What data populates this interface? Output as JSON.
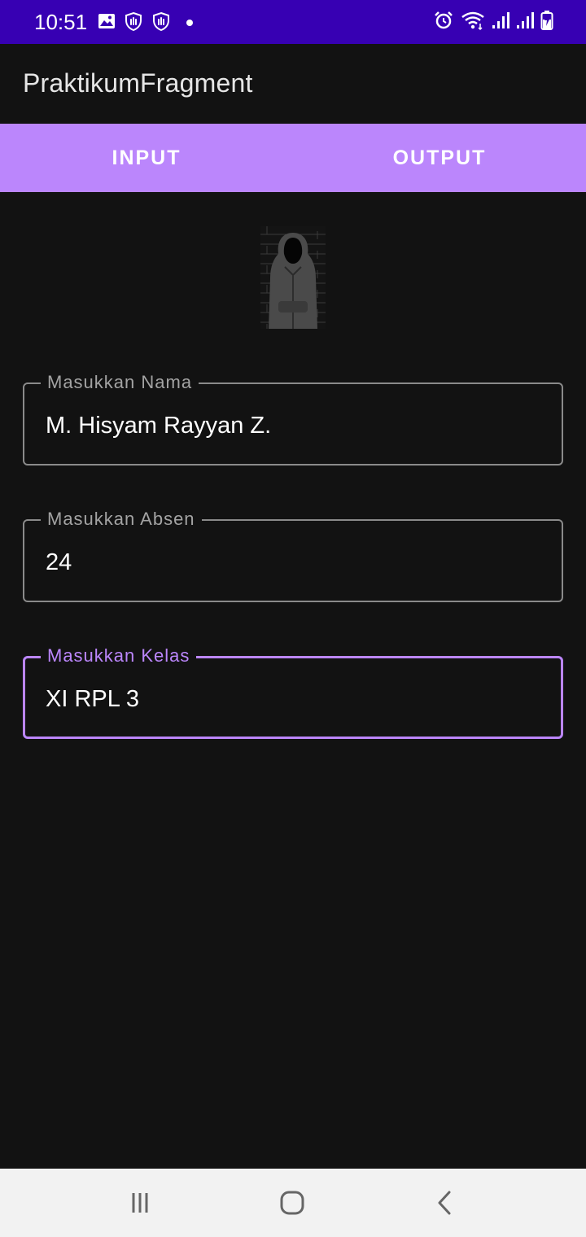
{
  "status_bar": {
    "time": "10:51",
    "left_icons": [
      "image-icon",
      "hand-shield-icon",
      "hand-shield-icon",
      "dot-icon"
    ],
    "right_icons": [
      "alarm-icon",
      "wifi-icon",
      "signal-icon",
      "signal-icon",
      "battery-charging-icon"
    ],
    "background": "#3700b3"
  },
  "app_bar": {
    "title": "PraktikumFragment"
  },
  "tabs": [
    {
      "label": "INPUT"
    },
    {
      "label": "OUTPUT"
    }
  ],
  "tab_bar_color": "#bb86fc",
  "form": {
    "name_field": {
      "label": "Masukkan Nama",
      "value": "M. Hisyam Rayyan Z."
    },
    "absen_field": {
      "label": "Masukkan Absen",
      "value": "24"
    },
    "kelas_field": {
      "label": "Masukkan Kelas",
      "value": "XI RPL 3",
      "focused": true
    }
  },
  "accent_color": "#bb86fc",
  "nav_bar": {
    "buttons": [
      "recent-apps-icon",
      "home-icon",
      "back-icon"
    ]
  }
}
